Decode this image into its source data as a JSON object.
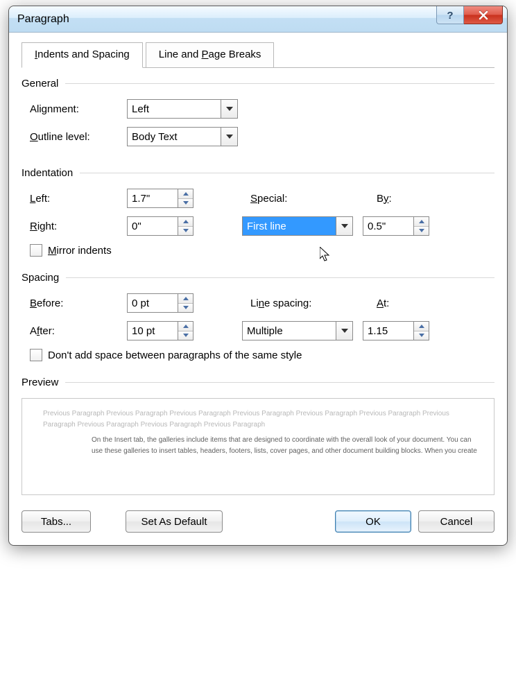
{
  "window": {
    "title": "Paragraph"
  },
  "tabs": {
    "indents": "Indents and Spacing",
    "breaks": "Line and Page Breaks"
  },
  "general": {
    "header": "General",
    "alignment_label": "Alignment:",
    "alignment_value": "Left",
    "outline_label": "Outline level:",
    "outline_value": "Body Text"
  },
  "indentation": {
    "header": "Indentation",
    "left_label": "Left:",
    "left_value": "1.7\"",
    "right_label": "Right:",
    "right_value": "0\"",
    "special_label": "Special:",
    "special_value": "First line",
    "by_label": "By:",
    "by_value": "0.5\"",
    "mirror_label": "Mirror indents"
  },
  "spacing": {
    "header": "Spacing",
    "before_label": "Before:",
    "before_value": "0 pt",
    "after_label": "After:",
    "after_value": "10 pt",
    "linespacing_label": "Line spacing:",
    "linespacing_value": "Multiple",
    "at_label": "At:",
    "at_value": "1.15",
    "dontadd_label": "Don't add space between paragraphs of the same style"
  },
  "preview": {
    "header": "Preview",
    "grey_text": "Previous Paragraph Previous Paragraph Previous Paragraph Previous Paragraph Previous Paragraph Previous Paragraph Previous Paragraph Previous Paragraph Previous Paragraph Previous Paragraph",
    "dark_text": "On the Insert tab, the galleries include items that are designed to coordinate with the overall look of your document. You can use these galleries to insert tables, headers, footers, lists, cover pages, and other document building blocks. When you create"
  },
  "buttons": {
    "tabs": "Tabs...",
    "default": "Set As Default",
    "ok": "OK",
    "cancel": "Cancel"
  }
}
